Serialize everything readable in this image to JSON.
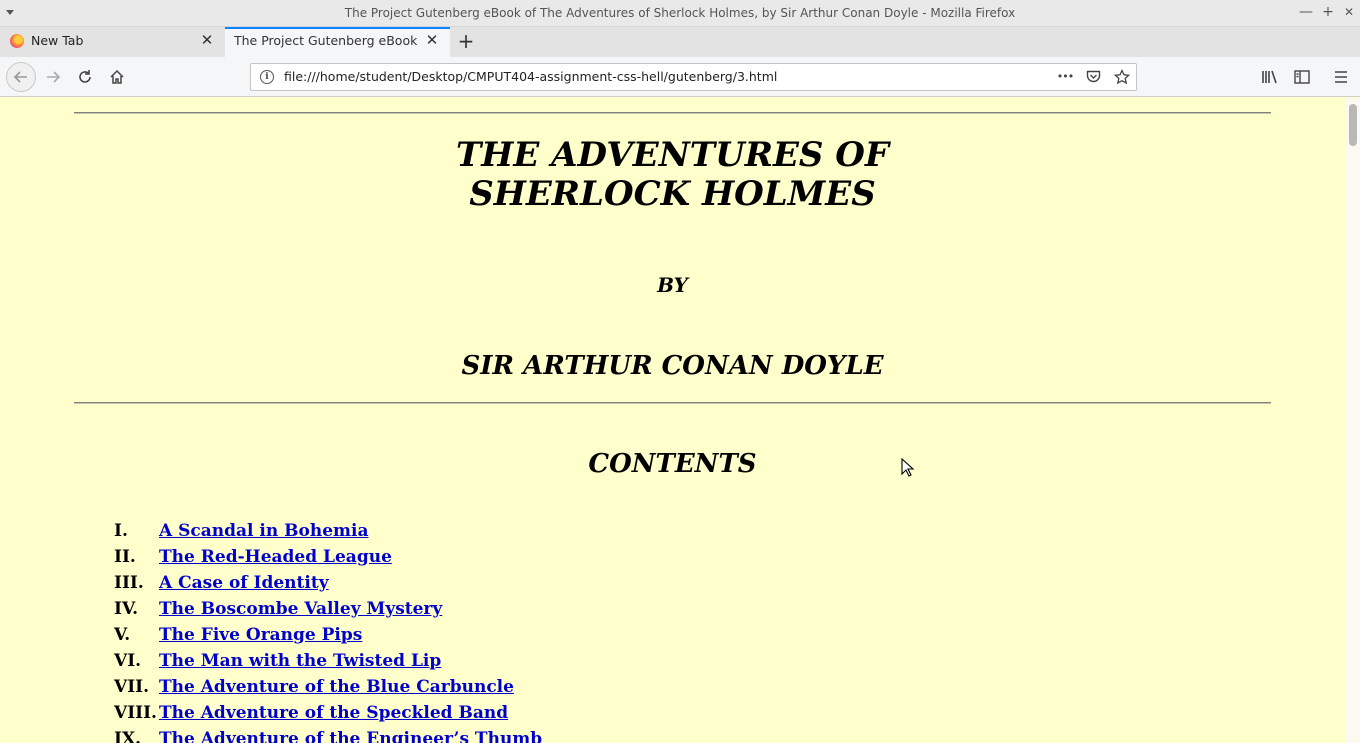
{
  "window": {
    "title": "The Project Gutenberg eBook of The Adventures of Sherlock Holmes, by Sir Arthur Conan Doyle - Mozilla Firefox",
    "minimize": "—",
    "maximize": "+",
    "close": "✕"
  },
  "tabs": [
    {
      "label": "New Tab",
      "close": "✕"
    },
    {
      "label": "The Project Gutenberg eBook of T",
      "close": "✕"
    }
  ],
  "new_tab": "+",
  "nav": {
    "url": "file:///home/student/Desktop/CMPUT404-assignment-css-hell/gutenberg/3.html",
    "info": "i",
    "more": "•••"
  },
  "page": {
    "title_line1": "THE ADVENTURES OF",
    "title_line2": "SHERLOCK HOLMES",
    "by": "BY",
    "author": "SIR ARTHUR CONAN DOYLE",
    "contents_heading": "CONTENTS",
    "toc": [
      {
        "num": "I.",
        "title": "A Scandal in Bohemia"
      },
      {
        "num": "II.",
        "title": "The Red-Headed League"
      },
      {
        "num": "III.",
        "title": "A Case of Identity"
      },
      {
        "num": "IV.",
        "title": "The Boscombe Valley Mystery"
      },
      {
        "num": "V.",
        "title": "The Five Orange Pips"
      },
      {
        "num": "VI.",
        "title": "The Man with the Twisted Lip"
      },
      {
        "num": "VII.",
        "title": "The Adventure of the Blue Carbuncle"
      },
      {
        "num": "VIII.",
        "title": "The Adventure of the Speckled Band"
      },
      {
        "num": "IX.",
        "title": "The Adventure of the Engineer’s Thumb"
      }
    ]
  },
  "colors": {
    "page_background": "#ffffcc",
    "link": "#0000cc",
    "active_tab_accent": "#0a84ff"
  }
}
